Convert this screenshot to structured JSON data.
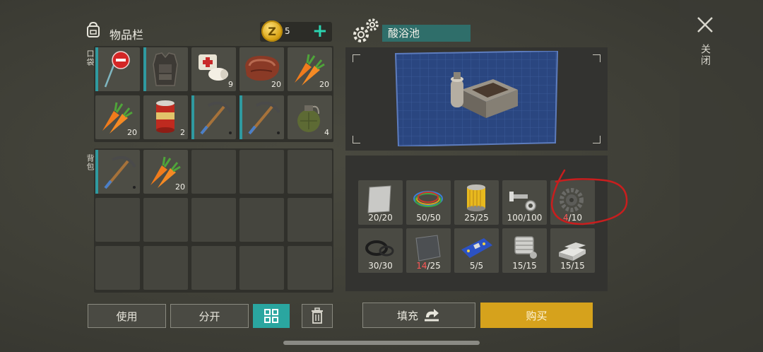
{
  "inventory": {
    "title": "物品栏",
    "coins": "5",
    "coin_symbol": "Z",
    "pocket_label": "口袋",
    "backpack_label": "背包",
    "pocket_slots": [
      {
        "icon": "stop-sign-icon",
        "qty": "",
        "marked": true
      },
      {
        "icon": "armor-vest-icon",
        "qty": "",
        "marked": true
      },
      {
        "icon": "bandage-icon",
        "qty": "9",
        "marked": false
      },
      {
        "icon": "steak-icon",
        "qty": "20",
        "marked": false
      },
      {
        "icon": "carrot-icon",
        "qty": "20",
        "marked": false
      },
      {
        "icon": "carrot-icon",
        "qty": "20",
        "marked": false
      },
      {
        "icon": "canned-food-icon",
        "qty": "2",
        "marked": false
      },
      {
        "icon": "pickaxe-icon",
        "qty": "",
        "marked": true
      },
      {
        "icon": "pickaxe-icon",
        "qty": "",
        "marked": true
      },
      {
        "icon": "grenade-icon",
        "qty": "4",
        "marked": false
      }
    ],
    "backpack_slots": [
      {
        "icon": "pickaxe-icon",
        "qty": "",
        "marked": true
      },
      {
        "icon": "carrot-icon",
        "qty": "20",
        "marked": false
      }
    ]
  },
  "crafting": {
    "title": "酸浴池",
    "materials": [
      {
        "icon": "metal-sheet-icon",
        "have": "20",
        "need": "20",
        "low": false
      },
      {
        "icon": "wires-icon",
        "have": "50",
        "need": "50",
        "low": false
      },
      {
        "icon": "filter-icon",
        "have": "25",
        "need": "25",
        "low": false
      },
      {
        "icon": "bolts-icon",
        "have": "100",
        "need": "100",
        "low": false
      },
      {
        "icon": "gear-part-icon",
        "have": "4",
        "need": "10",
        "low": true
      },
      {
        "icon": "rubber-seals-icon",
        "have": "30",
        "need": "30",
        "low": false
      },
      {
        "icon": "steel-plate-icon",
        "have": "14",
        "need": "25",
        "low": true
      },
      {
        "icon": "circuit-board-icon",
        "have": "5",
        "need": "5",
        "low": false
      },
      {
        "icon": "engine-part-icon",
        "have": "15",
        "need": "15",
        "low": false
      },
      {
        "icon": "aluminum-ingot-icon",
        "have": "15",
        "need": "15",
        "low": false
      }
    ]
  },
  "buttons": {
    "use": "使用",
    "split": "分开",
    "fill": "填充",
    "buy": "购买"
  },
  "close_label": "关闭",
  "colors": {
    "accent": "#2aa6a0",
    "gold": "#d6a21c",
    "low": "#ff5757",
    "annotation": "#c81e1e"
  }
}
